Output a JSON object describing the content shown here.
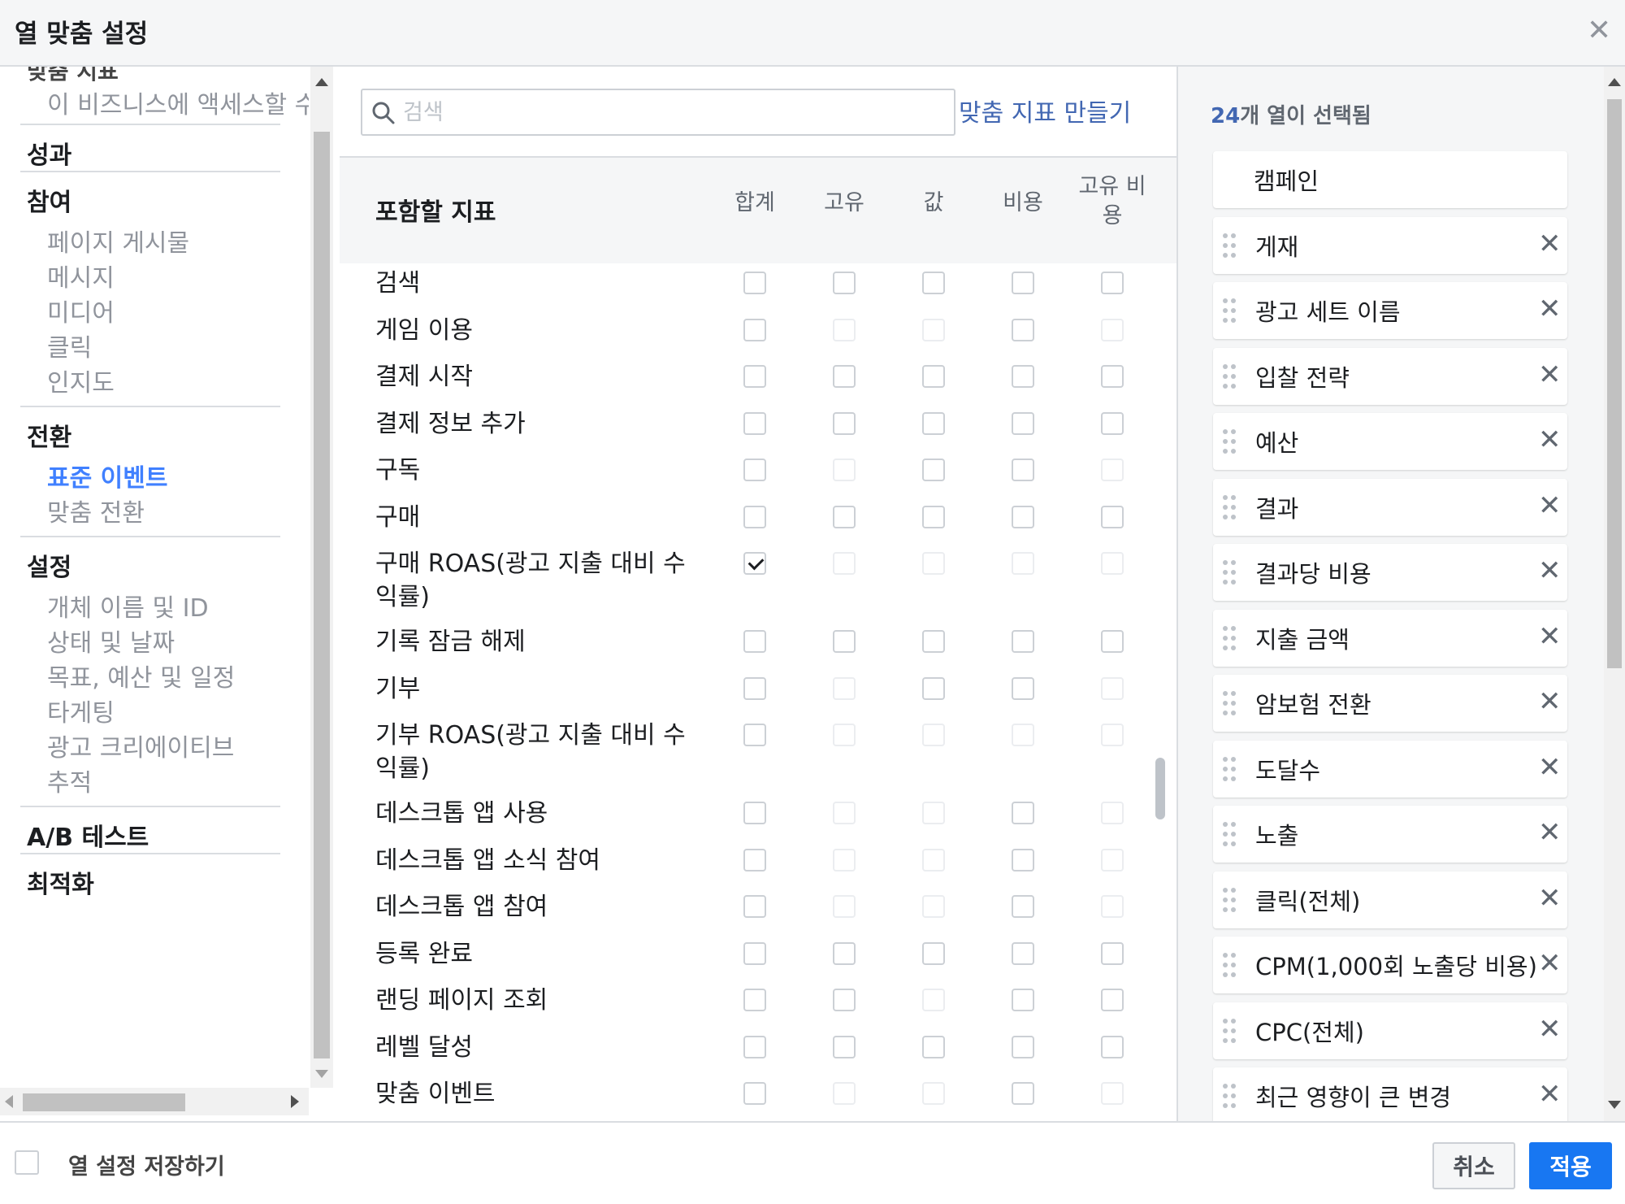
{
  "dialog": {
    "title": "열 맞춤 설정",
    "close_icon": "close-icon"
  },
  "nav": {
    "cut_text": "맞춤 지표",
    "top_item": "이 비즈니스에 액세스할 수 있는 사람",
    "sections": [
      {
        "title": "성과",
        "items": []
      },
      {
        "title": "참여",
        "items": [
          "페이지 게시물",
          "메시지",
          "미디어",
          "클릭",
          "인지도"
        ]
      },
      {
        "title": "전환",
        "items": [
          "표준 이벤트",
          "맞춤 전환"
        ]
      },
      {
        "title": "설정",
        "items": [
          "개체 이름 및 ID",
          "상태 및 날짜",
          "목표, 예산 및 일정",
          "타게팅",
          "광고 크리에이티브",
          "추적"
        ]
      },
      {
        "title": "A/B 테스트",
        "items": []
      },
      {
        "title": "최적화",
        "items": []
      }
    ],
    "active_item": "표준 이벤트"
  },
  "search": {
    "placeholder": "검색",
    "value": ""
  },
  "create_metric_label": "맞춤 지표 만들기",
  "table": {
    "header_label": "포함할 지표",
    "columns": [
      "합계",
      "고유",
      "값",
      "비용",
      "고유 비용"
    ],
    "rows": [
      {
        "label": "검색",
        "cb": [
          1,
          1,
          1,
          1,
          1
        ]
      },
      {
        "label": "게임 이용",
        "cb": [
          1,
          0,
          0,
          1,
          0
        ]
      },
      {
        "label": "결제 시작",
        "cb": [
          1,
          1,
          1,
          1,
          1
        ]
      },
      {
        "label": "결제 정보 추가",
        "cb": [
          1,
          1,
          1,
          1,
          1
        ]
      },
      {
        "label": "구독",
        "cb": [
          1,
          0,
          1,
          1,
          0
        ]
      },
      {
        "label": "구매",
        "cb": [
          1,
          1,
          1,
          1,
          1
        ]
      },
      {
        "label": "구매 ROAS(광고 지출 대비 수익률)",
        "cb": [
          2,
          0,
          0,
          0,
          0
        ]
      },
      {
        "label": "기록 잠금 해제",
        "cb": [
          1,
          1,
          1,
          1,
          1
        ]
      },
      {
        "label": "기부",
        "cb": [
          1,
          0,
          1,
          1,
          0
        ]
      },
      {
        "label": "기부 ROAS(광고 지출 대비 수익률)",
        "cb": [
          1,
          0,
          0,
          0,
          0
        ]
      },
      {
        "label": "데스크톱 앱 사용",
        "cb": [
          1,
          0,
          0,
          1,
          0
        ]
      },
      {
        "label": "데스크톱 앱 소식 참여",
        "cb": [
          1,
          0,
          0,
          1,
          0
        ]
      },
      {
        "label": "데스크톱 앱 참여",
        "cb": [
          1,
          0,
          0,
          1,
          0
        ]
      },
      {
        "label": "등록 완료",
        "cb": [
          1,
          1,
          1,
          1,
          1
        ]
      },
      {
        "label": "랜딩 페이지 조회",
        "cb": [
          1,
          1,
          0,
          1,
          1
        ]
      },
      {
        "label": "레벨 달성",
        "cb": [
          1,
          1,
          1,
          1,
          1
        ]
      },
      {
        "label": "맞춤 이벤트",
        "cb": [
          1,
          0,
          0,
          1,
          0
        ]
      }
    ]
  },
  "selected": {
    "count": "24",
    "count_suffix": "개 열이 선택됨",
    "items": [
      "캠페인",
      "게재",
      "광고 세트 이름",
      "입찰 전략",
      "예산",
      "결과",
      "결과당 비용",
      "지출 금액",
      "암보험 전환",
      "도달수",
      "노출",
      "클릭(전체)",
      "CPM(1,000회 노출당 비용)",
      "CPC(전체)",
      "최근 영향이 큰 변경"
    ],
    "remove_glyph": "✕"
  },
  "footer": {
    "save_label": "열 설정 저장하기",
    "cancel_label": "취소",
    "apply_label": "적용"
  },
  "colors": {
    "accent": "#4267b2",
    "primary_button": "#1877f2",
    "active_nav": "#4080ff"
  }
}
